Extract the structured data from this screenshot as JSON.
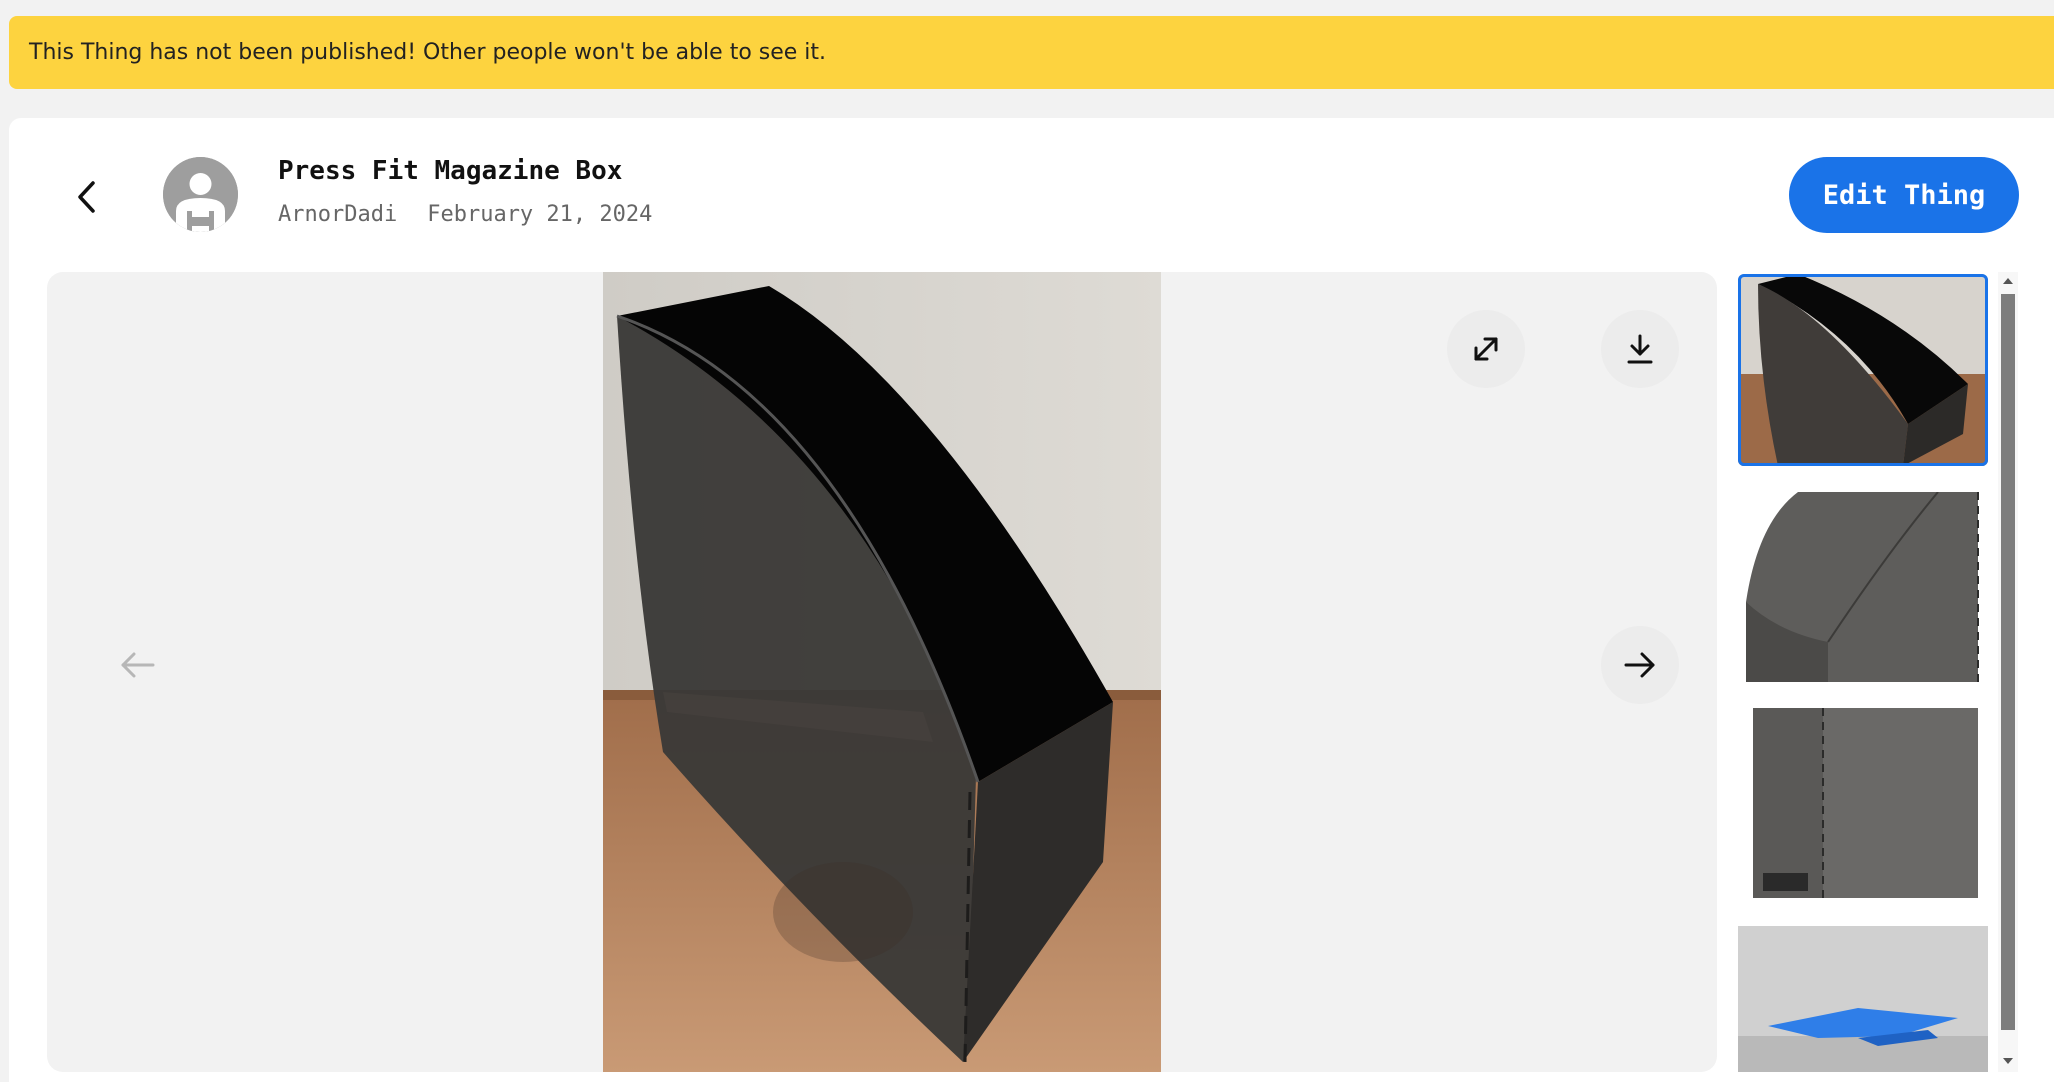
{
  "banner": {
    "text": "This Thing has not been published! Other people won't be able to see it."
  },
  "header": {
    "title": "Press Fit Magazine Box",
    "author": "ArnorDadi",
    "date": "February 21, 2024",
    "edit_label": "Edit Thing"
  },
  "viewer": {
    "icons": [
      "chevron-left-icon",
      "expand-icon",
      "download-icon",
      "arrow-left-icon",
      "arrow-right-icon"
    ],
    "prev_disabled": true
  },
  "thumbnails": [
    {
      "name": "photo-magazine-box",
      "selected": true
    },
    {
      "name": "render-box-front"
    },
    {
      "name": "render-box-side"
    },
    {
      "name": "render-flat-parts"
    }
  ],
  "colors": {
    "banner": "#fdd33f",
    "accent": "#1a73e8",
    "page_bg": "#f2f2f2"
  }
}
